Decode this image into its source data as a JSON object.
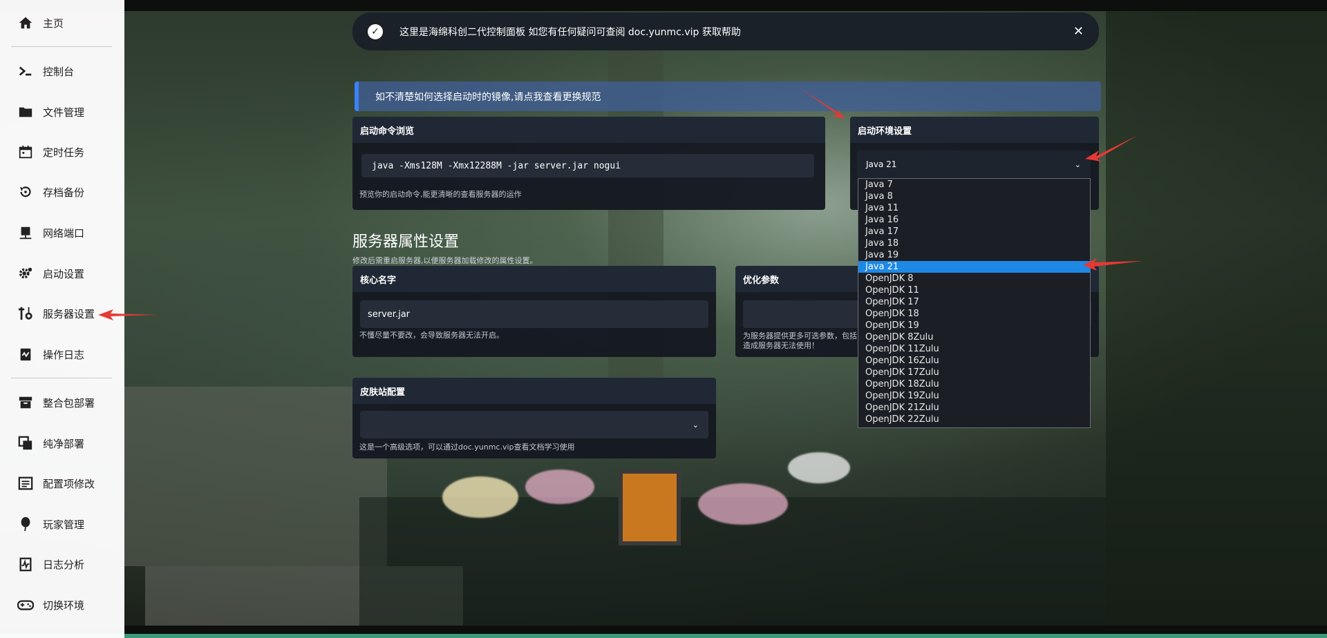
{
  "sidebar": {
    "items": [
      {
        "label": "主页",
        "icon": "home-icon"
      },
      {
        "label": "控制台",
        "icon": "terminal-icon"
      },
      {
        "label": "文件管理",
        "icon": "folder-icon"
      },
      {
        "label": "定时任务",
        "icon": "calendar-icon"
      },
      {
        "label": "存档备份",
        "icon": "backup-icon"
      },
      {
        "label": "网络端口",
        "icon": "network-icon"
      },
      {
        "label": "启动设置",
        "icon": "gear-icon"
      },
      {
        "label": "服务器设置",
        "icon": "wrench-icon"
      },
      {
        "label": "操作日志",
        "icon": "log-icon"
      },
      {
        "label": "整合包部署",
        "icon": "package-icon"
      },
      {
        "label": "纯净部署",
        "icon": "copy-icon"
      },
      {
        "label": "配置项修改",
        "icon": "config-icon"
      },
      {
        "label": "玩家管理",
        "icon": "balloon-icon"
      },
      {
        "label": "日志分析",
        "icon": "analysis-icon"
      },
      {
        "label": "切换环境",
        "icon": "gamepad-icon"
      }
    ]
  },
  "notice": {
    "text": "这里是海绵科创二代控制面板 如您有任何疑问可查阅 doc.yunmc.vip 获取帮助",
    "close": "✕"
  },
  "info_banner": "如不清楚如何选择启动时的镜像,请点我查看更换规范",
  "startup_preview": {
    "title": "启动命令浏览",
    "command": "java -Xms128M -Xmx12288M -jar server.jar nogui",
    "hint": "预览你的启动命令,能更清晰的查看服务器的运作"
  },
  "env_settings": {
    "title": "启动环境设置",
    "selected": "Java 21",
    "options": [
      "Java 7",
      "Java 8",
      "Java 11",
      "Java 16",
      "Java 17",
      "Java 18",
      "Java 19",
      "Java 21",
      "OpenJDK 8",
      "OpenJDK 11",
      "OpenJDK 17",
      "OpenJDK 18",
      "OpenJDK 19",
      "OpenJDK 8Zulu",
      "OpenJDK 11Zulu",
      "OpenJDK 16Zulu",
      "OpenJDK 17Zulu",
      "OpenJDK 18Zulu",
      "OpenJDK 19Zulu",
      "OpenJDK 21Zulu",
      "OpenJDK 22Zulu"
    ]
  },
  "server_props": {
    "title": "服务器属性设置",
    "subtitle": "修改后需重启服务器,以便服务器加载修改的属性设置。"
  },
  "core_name": {
    "title": "核心名字",
    "value": "server.jar",
    "hint": "不懂尽量不要改，会导致服务器无法开启。"
  },
  "optimize": {
    "title": "优化参数",
    "hint_line1": "为服务器提供更多可选参数，包括",
    "hint_line2": "造成服务器无法使用！"
  },
  "skin_site": {
    "title": "皮肤站配置",
    "hint": "这是一个高级选项，可以通过doc.yunmc.vip查看文档学习使用"
  },
  "colors": {
    "accent": "#1e88e5",
    "banner_border": "#3b82f6",
    "annotation_arrow": "#e53935"
  }
}
